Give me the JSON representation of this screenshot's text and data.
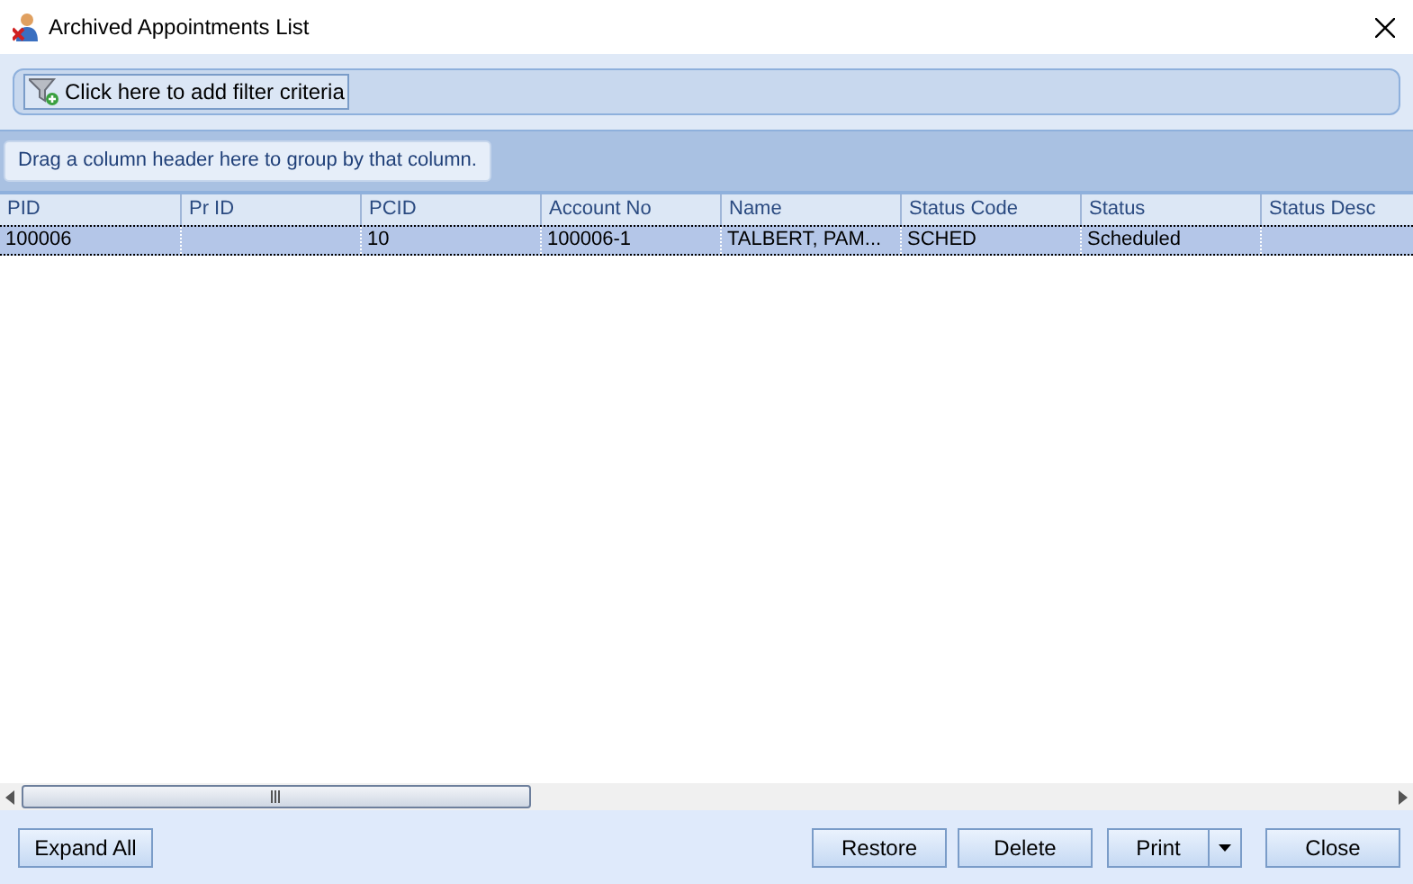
{
  "window": {
    "title": "Archived Appointments List"
  },
  "filter_button": {
    "label": "Click here to add filter criteria"
  },
  "group_panel": {
    "hint": "Drag a column header here to group by that column."
  },
  "table": {
    "columns": [
      "PID",
      "Pr ID",
      "PCID",
      "Account No",
      "Name",
      "Status Code",
      "Status",
      "Status Desc"
    ],
    "rows": [
      {
        "selected": true,
        "cells": [
          "100006",
          "",
          "10",
          "100006-1",
          "TALBERT,  PAM...",
          "SCHED",
          "Scheduled",
          ""
        ]
      }
    ]
  },
  "buttons": {
    "left": [
      "Expand All"
    ],
    "right": [
      {
        "label": "Restore",
        "kind": "plain"
      },
      {
        "label": "Delete",
        "kind": "plain"
      },
      {
        "label": "Print",
        "kind": "split"
      },
      {
        "label": "Close",
        "kind": "plain"
      }
    ]
  }
}
